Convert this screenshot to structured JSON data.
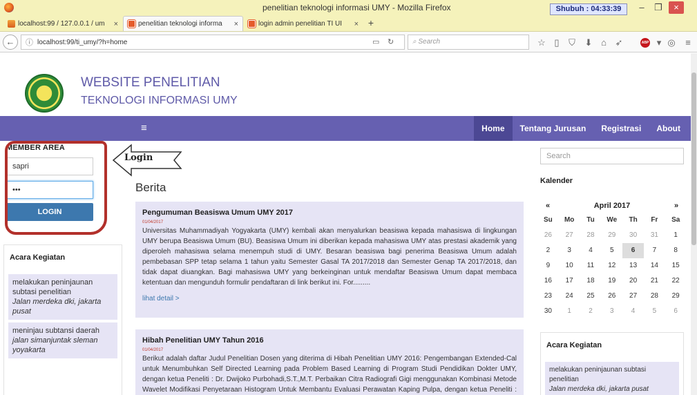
{
  "window": {
    "title": "penelitian teknologi informasi UMY - Mozilla Firefox",
    "clock": "Shubuh : 04:33:39",
    "min": "–",
    "max": "❐",
    "close": "×"
  },
  "tabs": [
    {
      "label": "localhost:99 / 127.0.0.1 / um"
    },
    {
      "label": "penelitian teknologi informa"
    },
    {
      "label": "login admin penelitian TI UI"
    }
  ],
  "tab_close": "×",
  "new_tab": "+",
  "toolbar": {
    "url": "localhost:99/ti_umy/?h=home",
    "search_placeholder": "Search"
  },
  "site": {
    "title_line1": "WEBSITE PENELITIAN",
    "title_line2": "TEKNOLOGI INFORMASI UMY",
    "hamburger": "≡",
    "menu": [
      "Home",
      "Tentang Jurusan",
      "Registrasi",
      "About"
    ]
  },
  "member": {
    "title": "MEMBER AREA",
    "username": "sapri",
    "password": "•••",
    "login_label": "LOGIN"
  },
  "annotation": {
    "label": "Login"
  },
  "acara_left": {
    "heading": "Acara Kegiatan",
    "items": [
      {
        "title": "melakukan peninjaunan subtasi penelitian",
        "location": "Jalan merdeka dki, jakarta pusat"
      },
      {
        "title": "meninjau subtansi daerah",
        "location": "jalan simanjuntak sleman yoyakarta"
      }
    ]
  },
  "main": {
    "heading": "Berita",
    "articles": [
      {
        "title": "Pengumuman Beasiswa Umum UMY 2017",
        "date": "01/04/2017",
        "body": "Universitas Muhammadiyah Yogyakarta (UMY) kembali akan menyalurkan beasiswa kepada mahasiswa di lingkungan UMY berupa Beasiswa Umum (BU). Beasiswa Umum ini diberikan kepada mahasiswa UMY atas prestasi akademik yang diperoleh mahasiswa selama menempuh studi di UMY. Besaran beasiswa bagi penerima Beasiswa Umum adalah pembebasan SPP tetap selama 1 tahun yaitu Semester Gasal TA 2017/2018 dan Semester Genap TA 2017/2018, dan tidak dapat diuangkan. Bagi mahasiswa UMY yang berkeinginan untuk mendaftar Beasiswa Umum dapat membaca ketentuan dan mengunduh formulir pendaftaran di link berikut ini. For.........",
        "more": "lihat detail >"
      },
      {
        "title": "Hibah Penelitian UMY Tahun 2016",
        "date": "01/04/2017",
        "body": "Berikut adalah daftar Judul Penelitian Dosen yang diterima di Hibah Penelitian UMY 2016: Pengembangan Extended-Cal untuk Menumbuhkan Self Directed Learning pada Problem Based Learning di Program Studi Pendidikan Dokter UMY, dengan ketua Peneliti : Dr. Dwijoko Purbohadi,S.T.,M.T. Perbaikan Citra Radiografi Gigi menggunakan Kombinasi Metode Wavelet Modifikasi Penyetaraan Histogram Untuk Membantu Evaluasi Perawatan Kaping Pulpa, dengan ketua Peneliti : Slamet Riyadi,"
      }
    ]
  },
  "sidebar_right": {
    "search_placeholder": "Search",
    "calendar_heading": "Kalender",
    "prev": "«",
    "next": "»",
    "month": "April 2017",
    "days_of_week": [
      "Su",
      "Mo",
      "Tu",
      "We",
      "Th",
      "Fr",
      "Sa"
    ],
    "weeks": [
      [
        "26",
        "27",
        "28",
        "29",
        "30",
        "31",
        "1"
      ],
      [
        "2",
        "3",
        "4",
        "5",
        "6",
        "7",
        "8"
      ],
      [
        "9",
        "10",
        "11",
        "12",
        "13",
        "14",
        "15"
      ],
      [
        "16",
        "17",
        "18",
        "19",
        "20",
        "21",
        "22"
      ],
      [
        "23",
        "24",
        "25",
        "26",
        "27",
        "28",
        "29"
      ],
      [
        "30",
        "1",
        "2",
        "3",
        "4",
        "5",
        "6"
      ]
    ],
    "today": "6",
    "acara_heading": "Acara Kegiatan",
    "acara_items": [
      {
        "title": "melakukan peninjaunan subtasi penelitian",
        "location": "Jalan merdeka dki, jakarta pusat"
      }
    ]
  }
}
